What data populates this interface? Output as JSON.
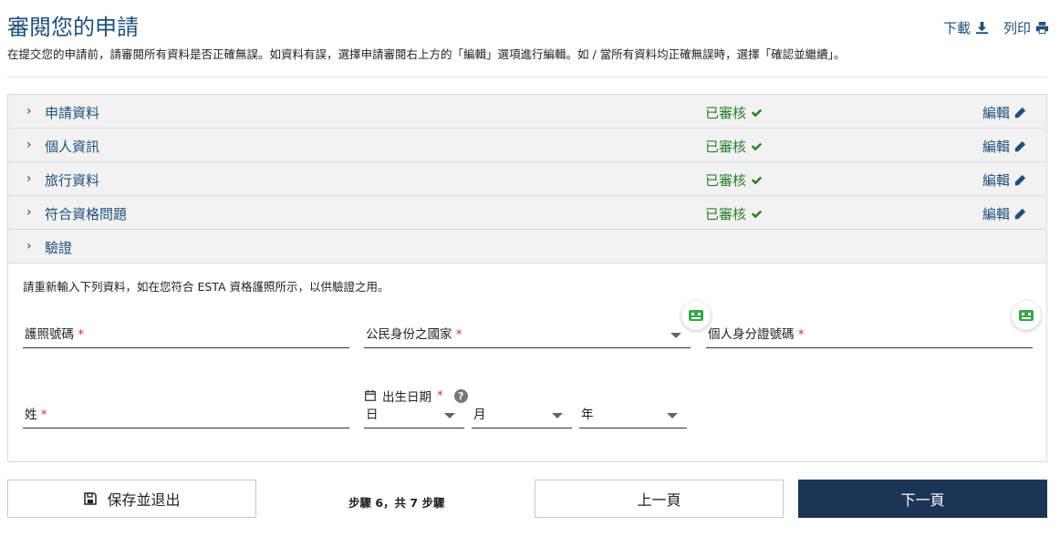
{
  "page": {
    "title": "審閱您的申請",
    "subtitle": "在提交您的申請前，請審閱所有資料是否正確無誤。如資料有誤，選擇申請審閱右上方的「編輯」選項進行編輯。如 / 當所有資料均正確無誤時，選擇「確認並繼續」。",
    "download_label": "下載",
    "print_label": "列印"
  },
  "sections": [
    {
      "label": "申請資料",
      "status": "已審核",
      "edit": "編輯"
    },
    {
      "label": "個人資訊",
      "status": "已審核",
      "edit": "編輯"
    },
    {
      "label": "旅行資料",
      "status": "已審核",
      "edit": "編輯"
    },
    {
      "label": "符合資格問題",
      "status": "已審核",
      "edit": "編輯"
    },
    {
      "label": "驗證"
    }
  ],
  "verification": {
    "instruction": "請重新輸入下列資料，如在您符合 ESTA 資格護照所示，以供驗證之用。",
    "passport_number_label": "護照號碼",
    "country_label": "公民身份之國家",
    "national_id_label": "個人身分證號碼",
    "surname_label": "姓",
    "dob_label": "出生日期",
    "day_label": "日",
    "month_label": "月",
    "year_label": "年",
    "required_mark": "*",
    "help_mark": "?"
  },
  "footer": {
    "save_label": "保存並退出",
    "step_text": "步驟 6，共 7 步驟",
    "prev_label": "上一頁",
    "next_label": "下一頁"
  },
  "colors": {
    "accent": "#1f4f7a",
    "success": "#2a7d2e",
    "primary_button": "#1c3557",
    "required": "#c0392b"
  }
}
